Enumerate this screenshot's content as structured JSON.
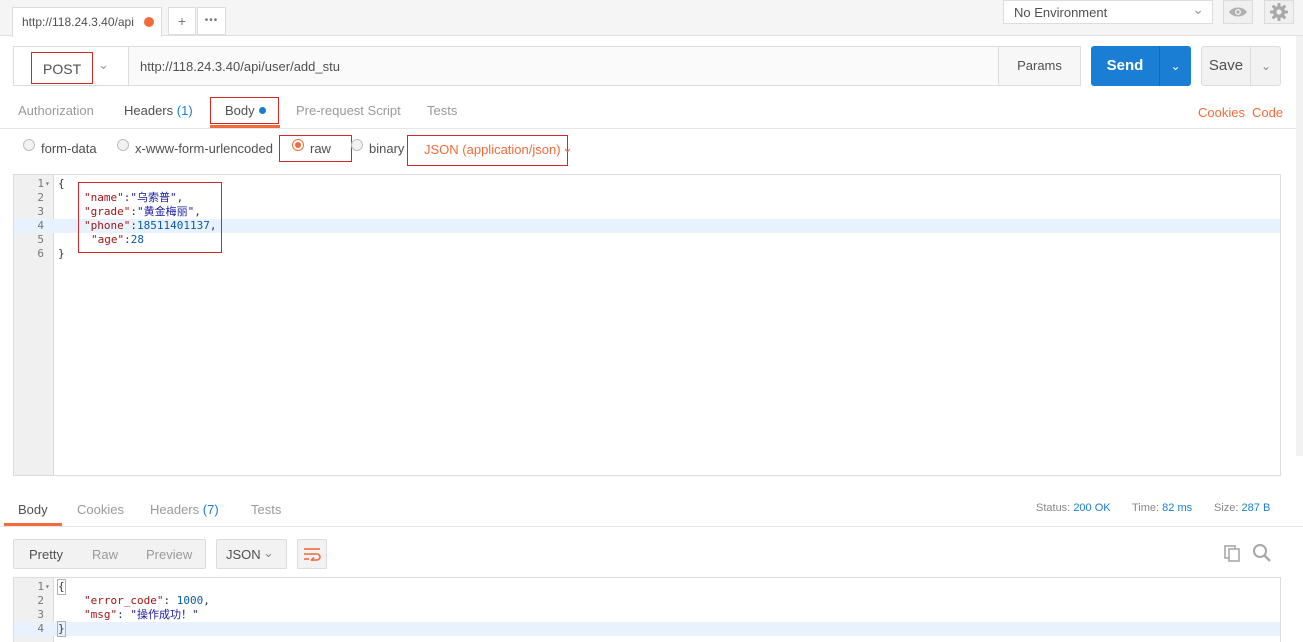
{
  "tabs": [
    {
      "label": "http://118.24.3.40/api"
    }
  ],
  "tab_bar": {
    "add_icon": "+",
    "more_icon": "•••"
  },
  "environment": {
    "selected": "No Environment"
  },
  "request": {
    "method": "POST",
    "url": "http://118.24.3.40/api/user/add_stu",
    "params_label": "Params",
    "send_label": "Send",
    "save_label": "Save"
  },
  "request_tabs": {
    "authorization": "Authorization",
    "headers": "Headers",
    "headers_count": "(1)",
    "body": "Body",
    "prerequest": "Pre-request Script",
    "tests": "Tests",
    "cookies": "Cookies",
    "code": "Code"
  },
  "body_types": {
    "form_data": "form-data",
    "urlencoded": "x-www-form-urlencoded",
    "raw": "raw",
    "binary": "binary",
    "selected": "raw",
    "content_type": "JSON (application/json)"
  },
  "request_body": {
    "line_numbers": [
      "1",
      "2",
      "3",
      "4",
      "5",
      "6"
    ],
    "open": "{",
    "close": "}",
    "fields": [
      {
        "key": "\"name\"",
        "sep": ":",
        "value": "\"乌索普\"",
        "tail": ","
      },
      {
        "key": "\"grade\"",
        "sep": ":",
        "value": "\"黄金梅丽\"",
        "tail": ","
      },
      {
        "key": "\"phone\"",
        "sep": ":",
        "value": "18511401137",
        "tail": ","
      },
      {
        "key": "\"age\"",
        "sep": ":",
        "value": "28",
        "tail": ""
      }
    ],
    "active_line": 4
  },
  "response_tabs": {
    "body": "Body",
    "cookies": "Cookies",
    "headers": "Headers",
    "headers_count": "(7)",
    "tests": "Tests"
  },
  "response_meta": {
    "status_label": "Status:",
    "status_value": "200 OK",
    "time_label": "Time:",
    "time_value": "82 ms",
    "size_label": "Size:",
    "size_value": "287 B"
  },
  "response_view": {
    "pretty": "Pretty",
    "raw": "Raw",
    "preview": "Preview",
    "format": "JSON"
  },
  "response_body": {
    "line_numbers": [
      "1",
      "2",
      "3",
      "4"
    ],
    "open": "{",
    "close": "}",
    "fields": [
      {
        "key": "\"error_code\"",
        "sep": ": ",
        "value": "1000",
        "tail": ","
      },
      {
        "key": "\"msg\"",
        "sep": ": ",
        "value": "\"操作成功！\"",
        "tail": ""
      }
    ],
    "active_line": 4
  },
  "colors": {
    "accent_orange": "#f26b3a",
    "send_blue": "#1a7fd4",
    "annotation_red": "#d42828"
  },
  "icons": {
    "eye": "eye-icon",
    "settings": "gear-icon",
    "copy": "copy-icon",
    "search": "search-icon",
    "wrap": "wrap-lines-icon"
  }
}
